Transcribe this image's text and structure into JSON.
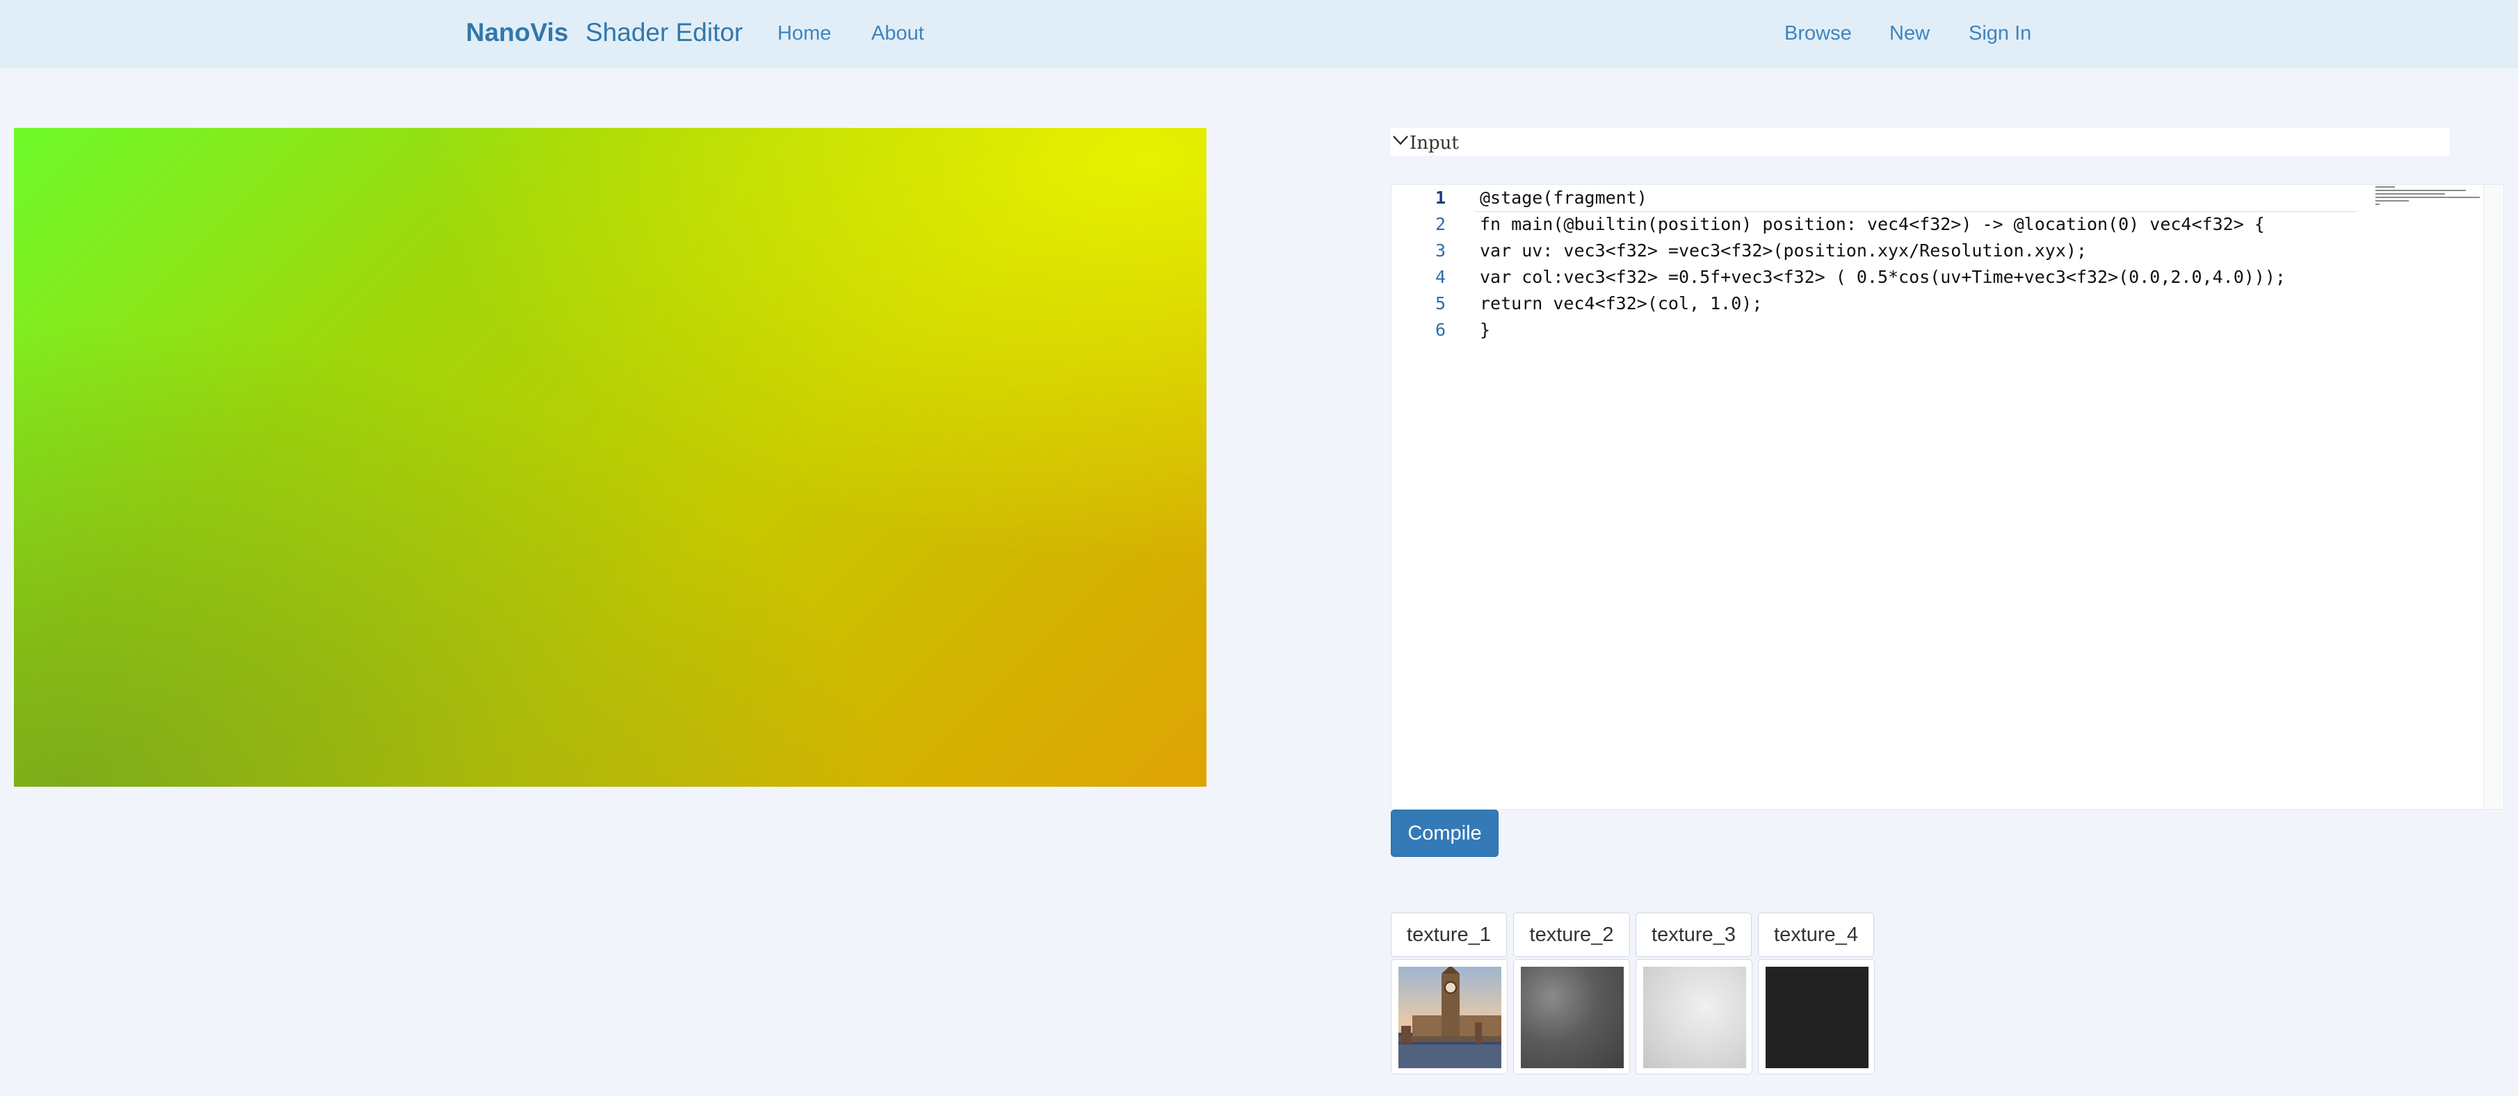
{
  "navbar": {
    "brand": "NanoVis",
    "title": "Shader Editor",
    "links": [
      "Home",
      "About"
    ],
    "right_links": [
      "Browse",
      "New",
      "Sign In"
    ]
  },
  "input_panel": {
    "label": "Input",
    "line_numbers": [
      "1",
      "2",
      "3",
      "4",
      "5",
      "6"
    ],
    "code_lines": [
      "@stage(fragment)",
      "fn main(@builtin(position) position: vec4<f32>) -> @location(0) vec4<f32> {",
      "var uv: vec3<f32> =vec3<f32>(position.xyx/Resolution.xyx);",
      "var col:vec3<f32> =0.5f+vec3<f32> ( 0.5*cos(uv+Time+vec3<f32>(0.0,2.0,4.0)));",
      "return vec4<f32>(col, 1.0);",
      "}"
    ],
    "active_line": 1
  },
  "compile_button": "Compile",
  "textures": {
    "tabs": [
      "texture_1",
      "texture_2",
      "texture_3",
      "texture_4"
    ],
    "thumbnails": [
      "city-clock-tower-photo",
      "dark-gray-noise",
      "light-gray-noise",
      "black-solid"
    ]
  },
  "colors": {
    "navbar_bg": "#e1eef8",
    "link": "#3f84be",
    "compile_bg": "#337ab7",
    "page_bg": "#f1f5fb"
  }
}
